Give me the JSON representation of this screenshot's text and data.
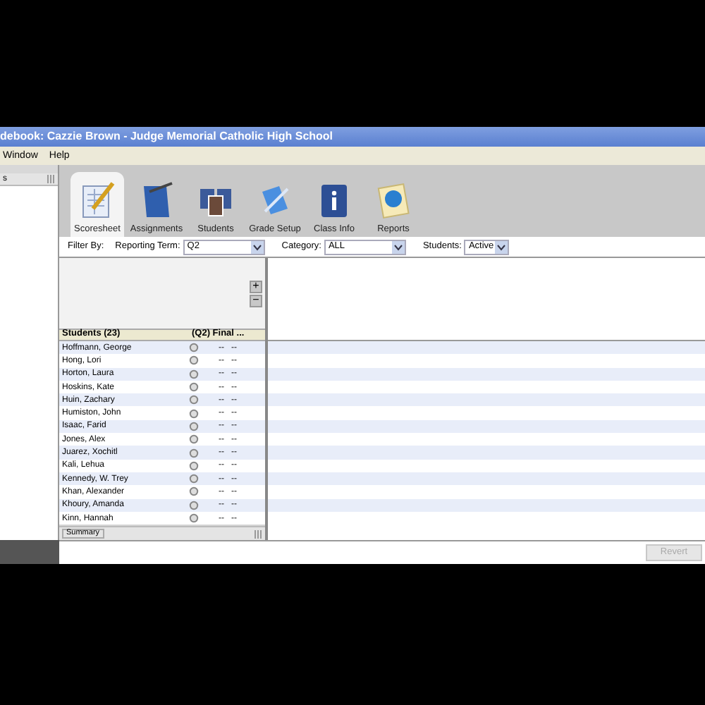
{
  "window": {
    "title": "debook: Cazzie Brown - Judge Memorial Catholic High School"
  },
  "menu": [
    "Window",
    "Help"
  ],
  "side_panel": {
    "header": "s"
  },
  "tabs": [
    {
      "label": "Scoresheet",
      "kind": "sheet",
      "selected": true
    },
    {
      "label": "Assignments",
      "kind": "book",
      "selected": false
    },
    {
      "label": "Students",
      "kind": "photos",
      "selected": false
    },
    {
      "label": "Grade Setup",
      "kind": "grade",
      "selected": false
    },
    {
      "label": "Class Info",
      "kind": "info",
      "selected": false
    },
    {
      "label": "Reports",
      "kind": "report",
      "selected": false
    }
  ],
  "filters": {
    "label": "Filter By:",
    "fields": [
      {
        "label": "Reporting Term:",
        "value": "Q2",
        "kind": "wide"
      },
      {
        "label": "Category:",
        "value": "ALL",
        "kind": "wide"
      },
      {
        "label": "Students:",
        "value": "Active",
        "kind": "narrow"
      }
    ]
  },
  "zoom_buttons": [
    "+",
    "−"
  ],
  "table": {
    "columns": [
      "Students (23)",
      "(Q2) Final ..."
    ],
    "rows": [
      [
        "Hoffmann, George",
        "--",
        "--"
      ],
      [
        "Hong, Lori",
        "--",
        "--"
      ],
      [
        "Horton, Laura",
        "--",
        "--"
      ],
      [
        "Hoskins, Kate",
        "--",
        "--"
      ],
      [
        "Huin, Zachary",
        "--",
        "--"
      ],
      [
        "Humiston, John",
        "--",
        "--"
      ],
      [
        "Isaac, Farid",
        "--",
        "--"
      ],
      [
        "Jones, Alex",
        "--",
        "--"
      ],
      [
        "Juarez, Xochitl",
        "--",
        "--"
      ],
      [
        "Kali, Lehua",
        "--",
        "--"
      ],
      [
        "Kennedy, W. Trey",
        "--",
        "--"
      ],
      [
        "Khan, Alexander",
        "--",
        "--"
      ],
      [
        "Khoury, Amanda",
        "--",
        "--"
      ],
      [
        "Kinn, Hannah",
        "--",
        "--"
      ]
    ],
    "footer": "Summary"
  },
  "revert_button": {
    "label": "Revert",
    "disabled": true
  }
}
